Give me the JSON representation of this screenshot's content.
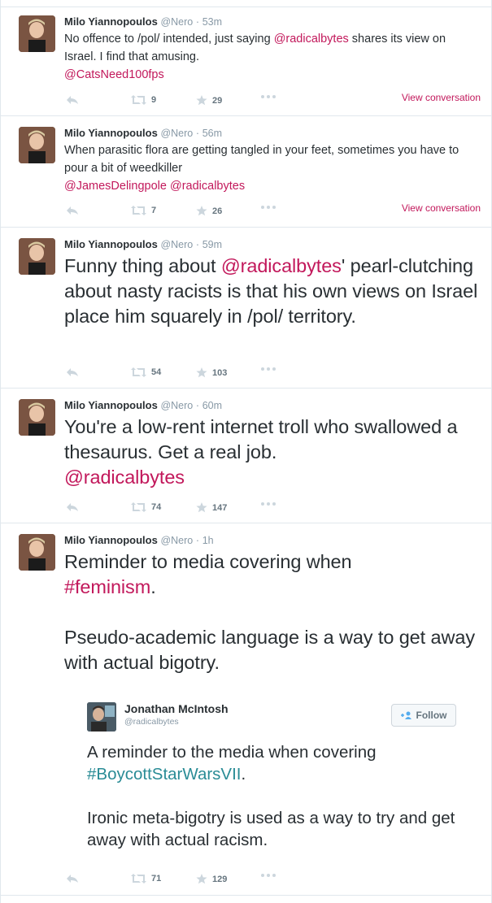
{
  "tweets": [
    {
      "fullname": "Milo Yiannopoulos",
      "handle": "@Nero",
      "time": "53m",
      "text": "No offence to /pol/ intended, just saying ",
      "mention": "@radicalbytes",
      "text_after": " shares its view on Israel. I find that amusing.",
      "mention_line": "@CatsNeed100fps",
      "retweets": "9",
      "favorites": "29",
      "view_conversation": "View conversation"
    },
    {
      "fullname": "Milo Yiannopoulos",
      "handle": "@Nero",
      "time": "56m",
      "text": "When parasitic flora are getting tangled in your feet, sometimes you have to pour a bit of weedkiller",
      "mention_line": "@JamesDelingpole @radicalbytes",
      "retweets": "7",
      "favorites": "26",
      "view_conversation": "View conversation"
    },
    {
      "fullname": "Milo Yiannopoulos",
      "handle": "@Nero",
      "time": "59m",
      "text_before": "Funny thing about ",
      "mention": "@radicalbytes",
      "text_after": "' pearl-clutching about nasty racists is that his own views on Israel place him squarely in /pol/ territory.",
      "retweets": "54",
      "favorites": "103"
    },
    {
      "fullname": "Milo Yiannopoulos",
      "handle": "@Nero",
      "time": "60m",
      "text": "You're a low-rent internet troll who swallowed a thesaurus. Get a real job.",
      "mention_line": "@radicalbytes",
      "retweets": "74",
      "favorites": "147"
    },
    {
      "fullname": "Milo Yiannopoulos",
      "handle": "@Nero",
      "time": "1h",
      "text_before": "Reminder to media covering when ",
      "hashtag": "#feminism",
      "text_after": ".",
      "paragraph2": "Pseudo-academic language is a way to get away with actual bigotry.",
      "retweets": "71",
      "favorites": "129"
    }
  ],
  "quote": {
    "name": "Jonathan McIntosh",
    "handle": "@radicalbytes",
    "follow_label": "Follow",
    "text_before": "A reminder to the media when covering ",
    "hashtag": "#BoycottStarWarsVII",
    "text_after": ".",
    "paragraph2": "Ironic meta-bigotry is used as a way to try and get away with actual racism."
  },
  "icons": {
    "reply": "reply-icon",
    "retweet": "retweet-icon",
    "favorite": "star-icon",
    "more": "more-icon",
    "follow": "follow-person-icon"
  },
  "colors": {
    "link": "#c2185b",
    "hashtag_quote": "#2a8c96",
    "muted": "#8899a6",
    "border": "#e1e8ed"
  }
}
